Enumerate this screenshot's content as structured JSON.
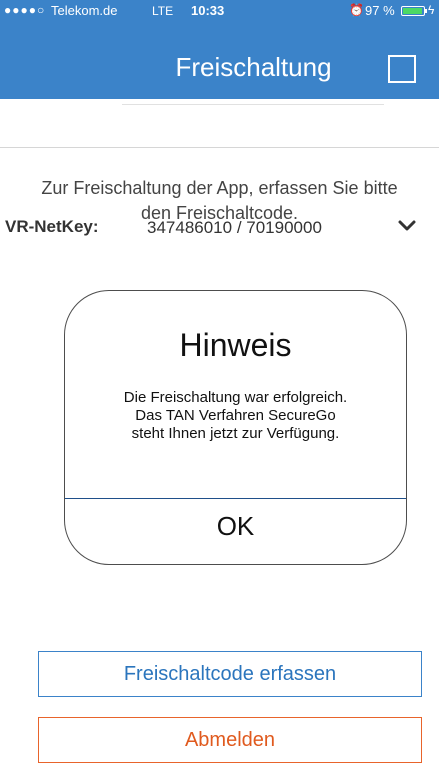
{
  "status_bar": {
    "signal": "●●●●○",
    "carrier": "Telekom.de",
    "network": "LTE",
    "time": "10:33",
    "alarm_icon": "alarm-icon",
    "battery_percent": "97 %",
    "battery_level": 0.97
  },
  "header": {
    "title": "Freischaltung"
  },
  "account": {
    "label": "VR-NetKey:",
    "value": "347486010 / 70190000"
  },
  "instruction": "Zur Freischaltung der App, erfassen Sie bitte den Freischaltcode.",
  "dialog": {
    "title": "Hinweis",
    "message": "Die Freischaltung war erfolgreich.\nDas TAN Verfahren  SecureGo\nsteht Ihnen jetzt  zur Verfügung.",
    "ok_label": "OK"
  },
  "buttons": {
    "enter_code": "Freischaltcode erfassen",
    "logout": "Abmelden"
  },
  "colors": {
    "header_bg": "#3b83c9",
    "primary": "#2b75bd",
    "logout": "#e05a1e"
  }
}
